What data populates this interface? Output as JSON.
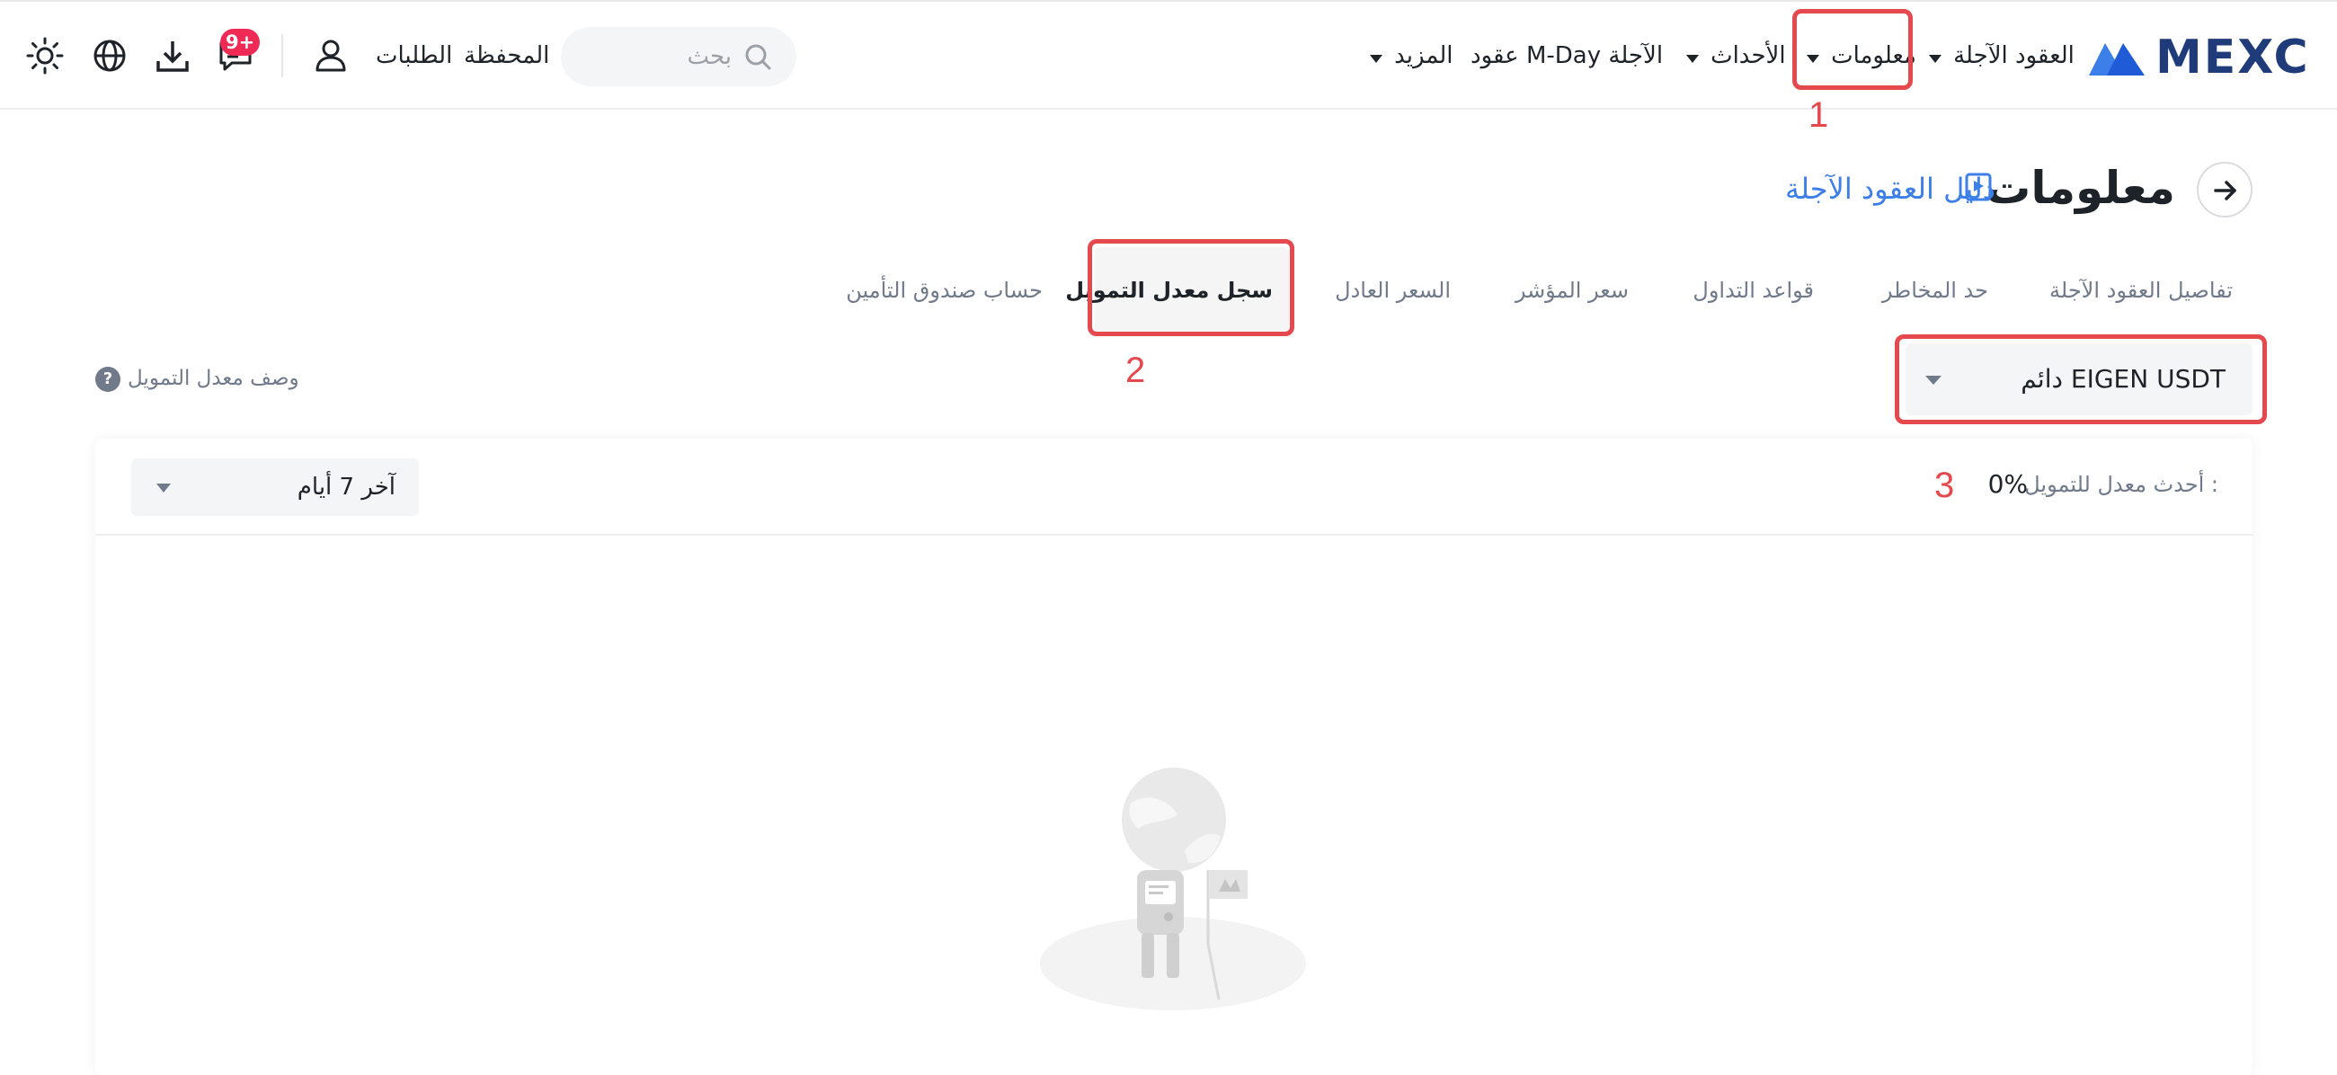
{
  "header": {
    "logo": "MEXC",
    "nav": {
      "futures": "العقود الآجلة",
      "info": "معلومات",
      "events": "الأحداث",
      "mday": "عقود M-Day الآجلة",
      "more": "المزيد"
    },
    "search_placeholder": "بحث",
    "wallet": "المحفظة",
    "orders": "الطلبات",
    "notification_badge": "9+"
  },
  "page": {
    "title": "معلومات",
    "guide_link": "دليل العقود الآجلة"
  },
  "tabs": [
    {
      "label": "تفاصيل العقود الآجلة",
      "active": false
    },
    {
      "label": "حد المخاطر",
      "active": false
    },
    {
      "label": "قواعد التداول",
      "active": false
    },
    {
      "label": "سعر المؤشر",
      "active": false
    },
    {
      "label": "السعر العادل",
      "active": false
    },
    {
      "label": "سجل معدل التمويل",
      "active": true
    },
    {
      "label": "حساب صندوق التأمين",
      "active": false
    }
  ],
  "symbol_select": {
    "value": "دائم EIGEN USDT"
  },
  "funding_desc_link": "وصف معدل التمويل",
  "card": {
    "latest_rate_label": "أحدث معدل للتمويل :",
    "latest_rate_value": "0%",
    "range_select": "آخر 7 أيام"
  },
  "annotations": [
    "1",
    "2",
    "3"
  ],
  "colors": {
    "brand": "#1f3b7a",
    "link": "#3d7fe8",
    "highlight": "#e5484d",
    "badge": "#ef2a55"
  }
}
